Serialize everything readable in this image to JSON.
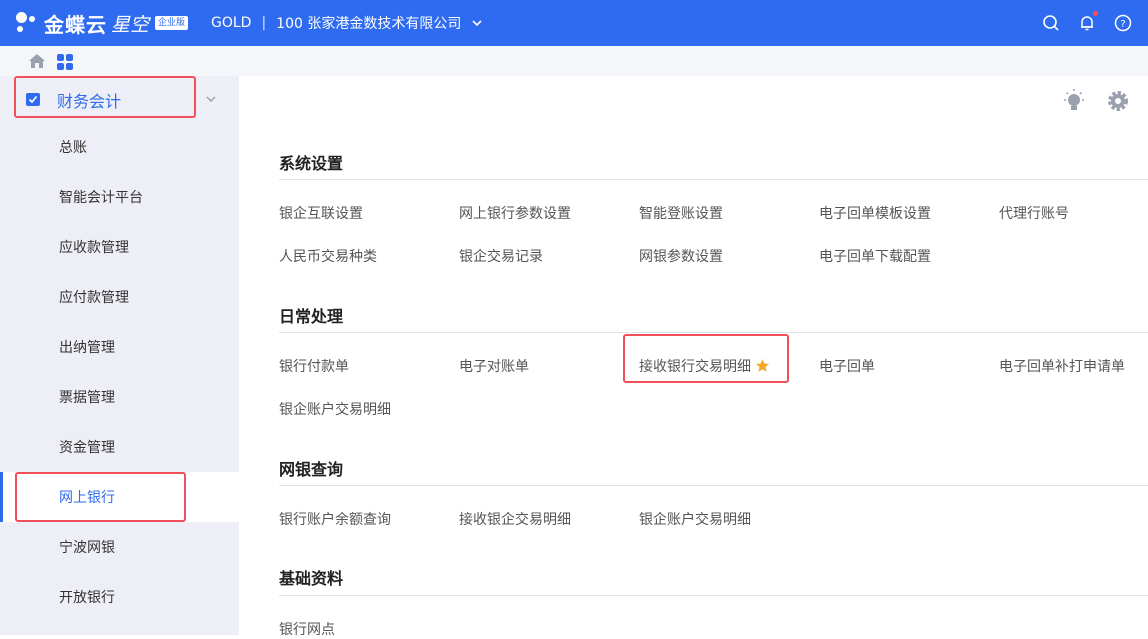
{
  "header": {
    "logo_text": "金蝶云",
    "logo_sub": "星空",
    "edition_badge": "企业版",
    "tenant": "GOLD",
    "separator": "|",
    "org": "100 张家港金数技术有限公司"
  },
  "colors": {
    "brand": "#2e6bf0",
    "highlight": "#f0505a",
    "star": "#f5a623",
    "sidebar_bg": "#eeeff6"
  },
  "sidebar": {
    "module": "财务会计",
    "items": [
      {
        "label": "总账"
      },
      {
        "label": "智能会计平台"
      },
      {
        "label": "应收款管理"
      },
      {
        "label": "应付款管理"
      },
      {
        "label": "出纳管理"
      },
      {
        "label": "票据管理"
      },
      {
        "label": "资金管理"
      },
      {
        "label": "网上银行"
      },
      {
        "label": "宁波网银"
      },
      {
        "label": "开放银行"
      }
    ],
    "active_index": 7
  },
  "sections": {
    "system": {
      "title": "系统设置",
      "links": [
        "银企互联设置",
        "网上银行参数设置",
        "智能登账设置",
        "电子回单模板设置",
        "代理行账号",
        "人民币交易种类",
        "银企交易记录",
        "网银参数设置",
        "电子回单下载配置"
      ]
    },
    "daily": {
      "title": "日常处理",
      "links": [
        "银行付款单",
        "电子对账单",
        "接收银行交易明细",
        "电子回单",
        "电子回单补打申请单",
        "银企账户交易明细"
      ]
    },
    "query": {
      "title": "网银查询",
      "links": [
        "银行账户余额查询",
        "接收银企交易明细",
        "银企账户交易明细"
      ]
    },
    "basic": {
      "title": "基础资料",
      "links": [
        "银行网点"
      ]
    }
  }
}
